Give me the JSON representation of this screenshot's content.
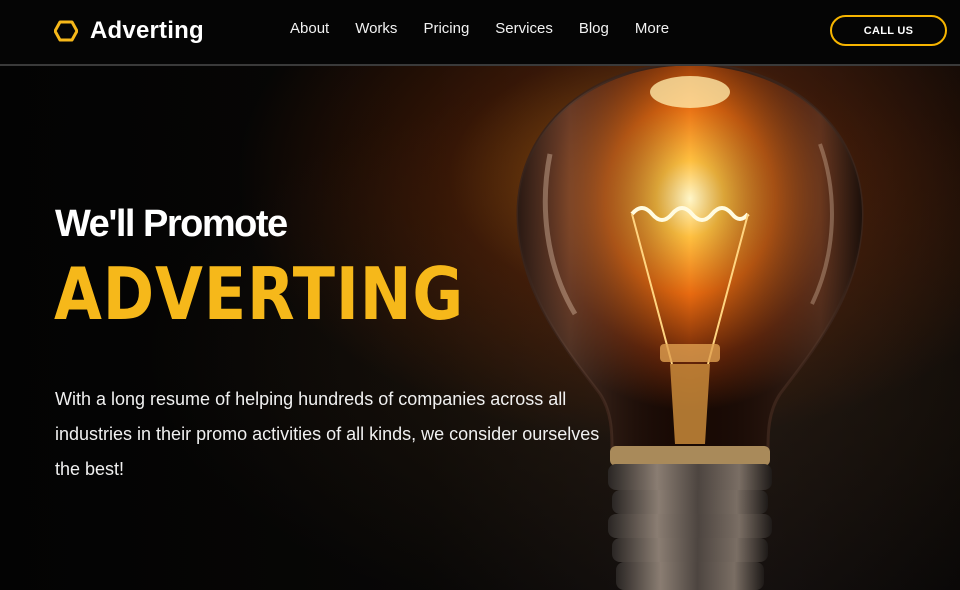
{
  "brand": {
    "name": "Adverting",
    "icon": "hexagon-outline-icon",
    "accent_color": "#f6b81a"
  },
  "nav": {
    "items": [
      {
        "label": "About"
      },
      {
        "label": "Works"
      },
      {
        "label": "Pricing"
      },
      {
        "label": "Services"
      },
      {
        "label": "Blog"
      },
      {
        "label": "More"
      }
    ],
    "cta_label": "CALL US"
  },
  "hero": {
    "subtitle": "We'll Promote",
    "title": "ADVERTING",
    "description": "With a long resume of helping hundreds of companies across all industries in their promo activities of all kinds, we consider ourselves the best!",
    "image": "light-bulb-image"
  }
}
